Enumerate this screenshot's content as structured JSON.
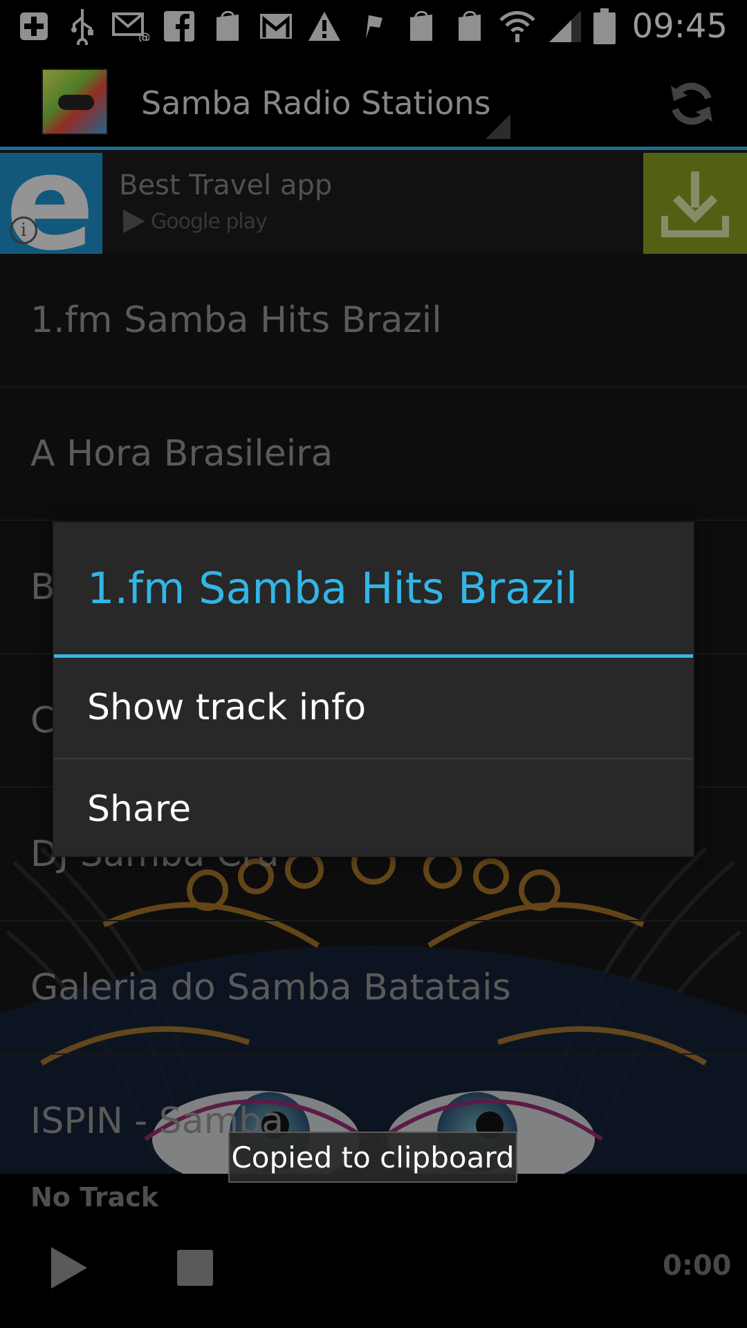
{
  "status_bar": {
    "time": "09:45"
  },
  "action_bar": {
    "title": "Samba Radio Stations"
  },
  "ad": {
    "logo_letter": "e",
    "title": "Best Travel app",
    "store_label": "Google play"
  },
  "stations": [
    {
      "label": "1.fm Samba Hits Brazil"
    },
    {
      "label": "A Hora Brasileira"
    },
    {
      "label": "B"
    },
    {
      "label": "C"
    },
    {
      "label": "DJ Samba Cru"
    },
    {
      "label": "Galeria do Samba Batatais"
    },
    {
      "label": "ISPIN - Samba"
    }
  ],
  "player": {
    "track": "No Track",
    "time": "0:00"
  },
  "dialog": {
    "title": "1.fm Samba Hits Brazil",
    "items": [
      {
        "label": "Show track info"
      },
      {
        "label": "Share"
      }
    ]
  },
  "toast": {
    "message": "Copied to clipboard"
  },
  "colors": {
    "accent": "#33b5e5",
    "ad_download": "#7e9420",
    "ad_logo": "#1d87bf"
  }
}
